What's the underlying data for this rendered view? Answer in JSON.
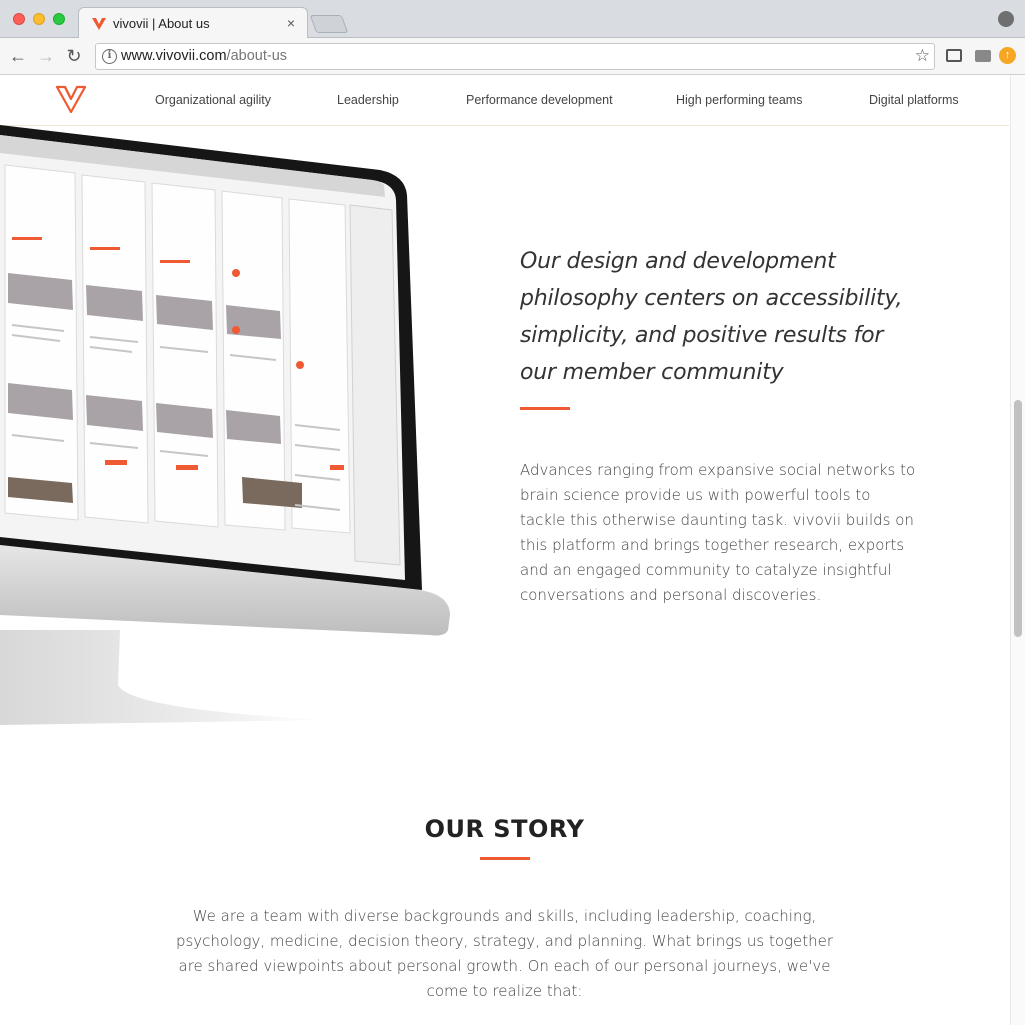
{
  "browser": {
    "tab_title": "vivovii | About us",
    "tab_close": "×",
    "url_host": "www.vivovii.com",
    "url_path": "/about-us"
  },
  "site_nav": {
    "items": [
      {
        "label": "Organizational agility"
      },
      {
        "label": "Leadership"
      },
      {
        "label": "Performance development"
      },
      {
        "label": "High performing teams"
      },
      {
        "label": "Digital platforms"
      }
    ]
  },
  "hero": {
    "quote": "Our design and development philosophy centers on accessibility, simplicity, and positive results for our member community",
    "body": "Advances ranging from expansive social networks to brain science provide us with powerful tools to tackle this otherwise daunting task. vivovii builds on this platform and brings together research, exports and an engaged community to catalyze insightful conversations and personal discoveries."
  },
  "story": {
    "title": "OUR STORY",
    "body": "We are a team with diverse backgrounds and skills, including leadership, coaching, psychology, medicine, decision theory, strategy, and planning. What brings us together are shared viewpoints about personal growth. On each of our personal journeys, we've come to realize that:"
  },
  "colors": {
    "accent": "#f05a32",
    "text": "#333333"
  }
}
